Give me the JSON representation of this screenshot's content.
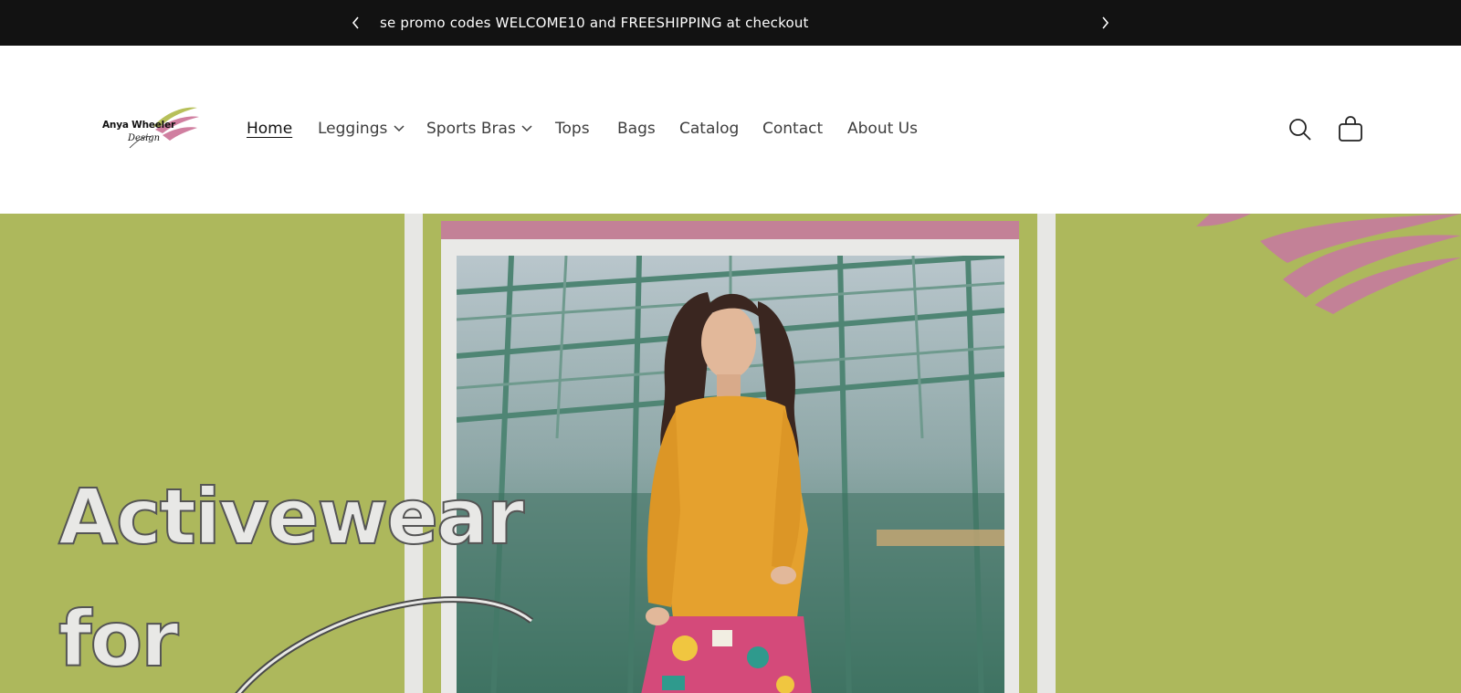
{
  "announcement": {
    "text": "se promo codes WELCOME10 and FREESHIPPING at checkout",
    "prev_icon": "chevron-left-icon",
    "next_icon": "chevron-right-icon"
  },
  "header": {
    "logo": {
      "name": "Anya Wheeler",
      "script": "Design"
    },
    "nav": [
      {
        "label": "Home",
        "active": true
      },
      {
        "label": "Leggings",
        "has_dropdown": true
      },
      {
        "label": "Sports Bras",
        "has_dropdown": true
      },
      {
        "label": "Tops"
      },
      {
        "label": "Bags"
      },
      {
        "label": "Catalog"
      },
      {
        "label": "Contact"
      },
      {
        "label": "About Us"
      }
    ],
    "icons": [
      "search-icon",
      "cart-icon"
    ]
  },
  "hero": {
    "headline_line1": "Activewear",
    "headline_line2": "for"
  },
  "colors": {
    "announcement_bg": "#121212",
    "hero_bg": "#adb85c",
    "accent_pink": "#c38197",
    "frame_gray": "#e7e7e4"
  }
}
